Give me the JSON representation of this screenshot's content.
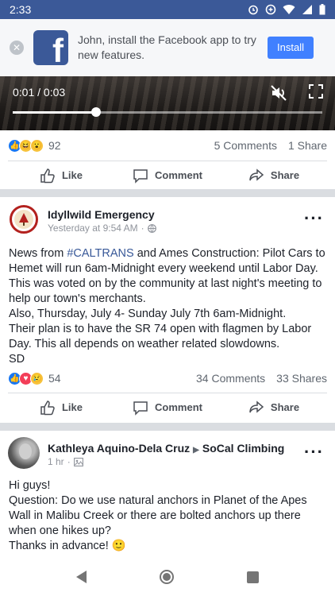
{
  "status_bar": {
    "time": "2:33"
  },
  "install_banner": {
    "message": "John, install the Facebook app to try new features.",
    "install_label": "Install",
    "logo_letter": "f"
  },
  "video": {
    "time": "0:01 / 0:03",
    "progress": 0.27
  },
  "post1_stats": {
    "reaction_count": "92",
    "comments": "5 Comments",
    "shares": "1 Share"
  },
  "actions": {
    "like": "Like",
    "comment": "Comment",
    "share": "Share"
  },
  "post2": {
    "author": "Idyllwild Emergency",
    "time": "Yesterday at 9:54 AM",
    "text_before_tag": "News from ",
    "hashtag": "#CALTRANS",
    "text_after_tag": " and Ames Construction: Pilot Cars to Hemet will run 6am-Midnight every weekend until Labor Day. This was voted on by the community at last night's meeting to help our town's merchants.",
    "line2": "Also, Thursday, July 4- Sunday July 7th 6am-Midnight.",
    "line3": "Their plan is to have the SR 74 open with flagmen by Labor Day. This all depends on weather related slowdowns.",
    "line4": "SD",
    "reaction_count": "54",
    "comments": "34 Comments",
    "shares": "33 Shares"
  },
  "post3": {
    "author": "Kathleya Aquino-Dela Cruz",
    "group": "SoCal Climbing",
    "time": "1 hr",
    "line1": "Hi guys!",
    "line2": "Question: Do we use natural anchors in Planet of the Apes Wall in Malibu Creek or there are bolted anchors up there when one hikes up?",
    "line3": "Thanks in advance! 🙂"
  },
  "colors": {
    "facebook_blue": "#3b5998",
    "install_blue": "#4080ff",
    "link": "#385898"
  }
}
